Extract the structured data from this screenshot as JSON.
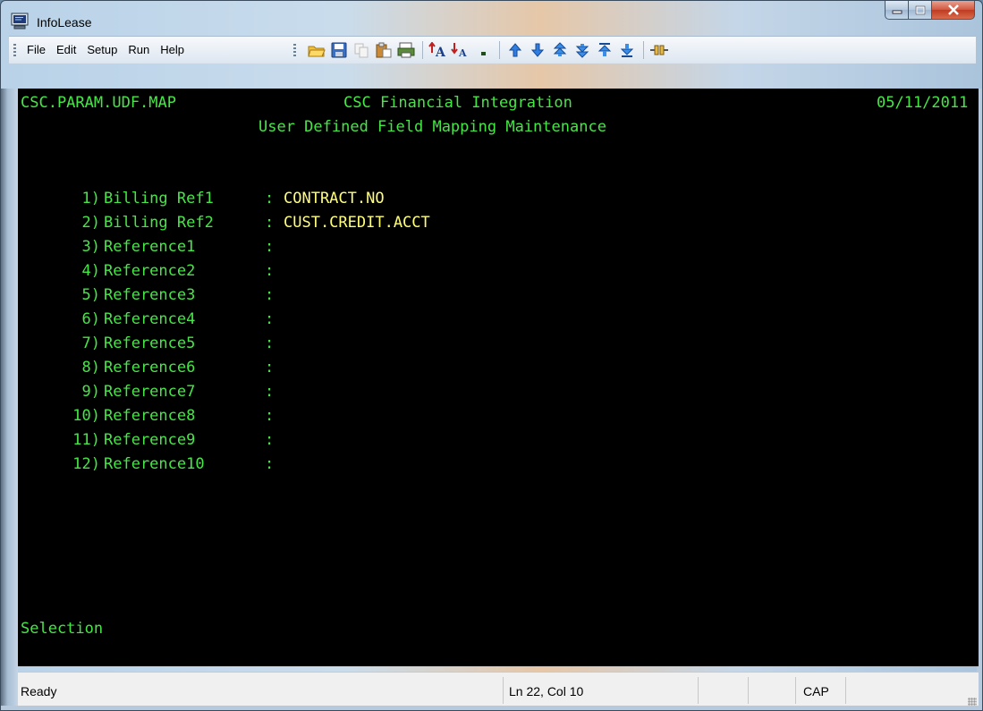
{
  "window": {
    "title": "InfoLease",
    "minimize": "—",
    "maximize": "□",
    "close": "✕"
  },
  "menu": [
    "File",
    "Edit",
    "Setup",
    "Run",
    "Help"
  ],
  "toolbar": [
    "open-icon",
    "save-icon",
    "copy-icon",
    "paste-icon",
    "print-icon",
    "font-larger-icon",
    "font-smaller-icon",
    "small-square-icon",
    "arrow-up-icon",
    "arrow-down-icon",
    "double-up-icon",
    "double-down-icon",
    "top-icon",
    "bottom-icon",
    "connect-icon"
  ],
  "screen": {
    "program": "CSC.PARAM.UDF.MAP",
    "title": "CSC Financial Integration",
    "subtitle": "User Defined Field Mapping Maintenance",
    "date": "05/11/2011",
    "fields": [
      {
        "num": "1)",
        "label": "Billing Ref1",
        "sep": ":",
        "value": "CONTRACT.NO"
      },
      {
        "num": "2)",
        "label": "Billing Ref2",
        "sep": ":",
        "value": "CUST.CREDIT.ACCT"
      },
      {
        "num": "3)",
        "label": "Reference1",
        "sep": ":",
        "value": ""
      },
      {
        "num": "4)",
        "label": "Reference2",
        "sep": ":",
        "value": ""
      },
      {
        "num": "5)",
        "label": "Reference3",
        "sep": ":",
        "value": ""
      },
      {
        "num": "6)",
        "label": "Reference4",
        "sep": ":",
        "value": ""
      },
      {
        "num": "7)",
        "label": "Reference5",
        "sep": ":",
        "value": ""
      },
      {
        "num": "8)",
        "label": "Reference6",
        "sep": ":",
        "value": ""
      },
      {
        "num": "9)",
        "label": "Reference7",
        "sep": ":",
        "value": ""
      },
      {
        "num": "10)",
        "label": "Reference8",
        "sep": ":",
        "value": ""
      },
      {
        "num": "11)",
        "label": "Reference9",
        "sep": ":",
        "value": ""
      },
      {
        "num": "12)",
        "label": "Reference10",
        "sep": ":",
        "value": ""
      }
    ],
    "prompt": "Selection"
  },
  "status": {
    "state": "Ready",
    "position": "Ln 22, Col 10",
    "caps": "CAP"
  },
  "colors": {
    "terminal_bg": "#000000",
    "label_green": "#46e646",
    "value_yellow": "#fffe78"
  }
}
